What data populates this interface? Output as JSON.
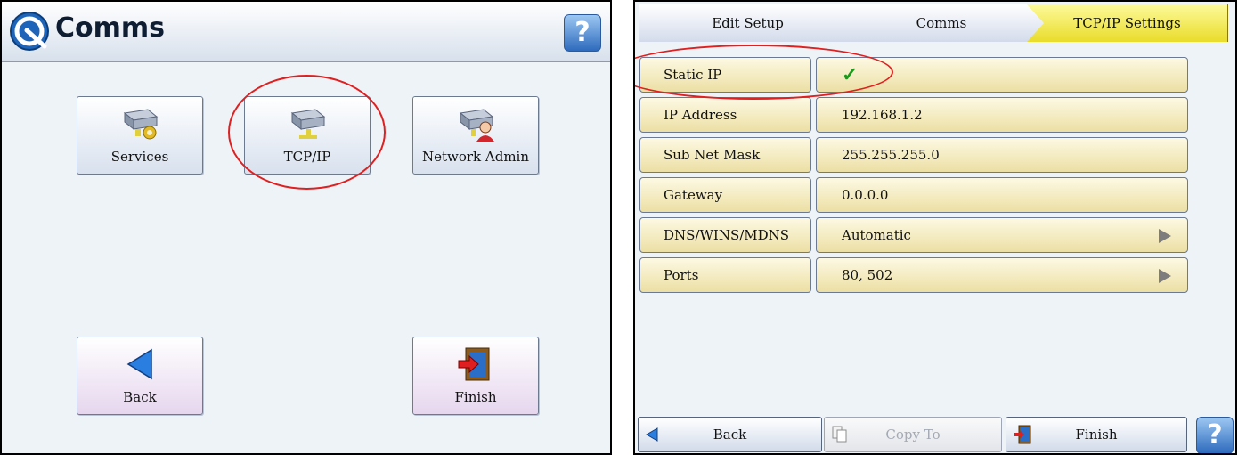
{
  "left_screen": {
    "title": "Comms",
    "help_label": "?",
    "tiles": {
      "services": "Services",
      "tcpip": "TCP/IP",
      "network_admin": "Network Admin",
      "back": "Back",
      "finish": "Finish"
    }
  },
  "right_screen": {
    "breadcrumbs": [
      "Edit Setup",
      "Comms",
      "TCP/IP Settings"
    ],
    "settings": [
      {
        "label": "Static IP",
        "value": "✓"
      },
      {
        "label": "IP Address",
        "value": "192.168.1.2"
      },
      {
        "label": "Sub Net Mask",
        "value": "255.255.255.0"
      },
      {
        "label": "Gateway",
        "value": "0.0.0.0"
      },
      {
        "label": "DNS/WINS/MDNS",
        "value": "Automatic"
      },
      {
        "label": "Ports",
        "value": "80, 502"
      }
    ],
    "footer": {
      "back": "Back",
      "copy_to": "Copy To",
      "finish": "Finish",
      "help": "?"
    }
  },
  "colors": {
    "highlight_circle": "#e02020",
    "active_crumb": "#f0e43a",
    "setting_row": "#f5edc6",
    "check_mark": "#1a9a1a"
  }
}
